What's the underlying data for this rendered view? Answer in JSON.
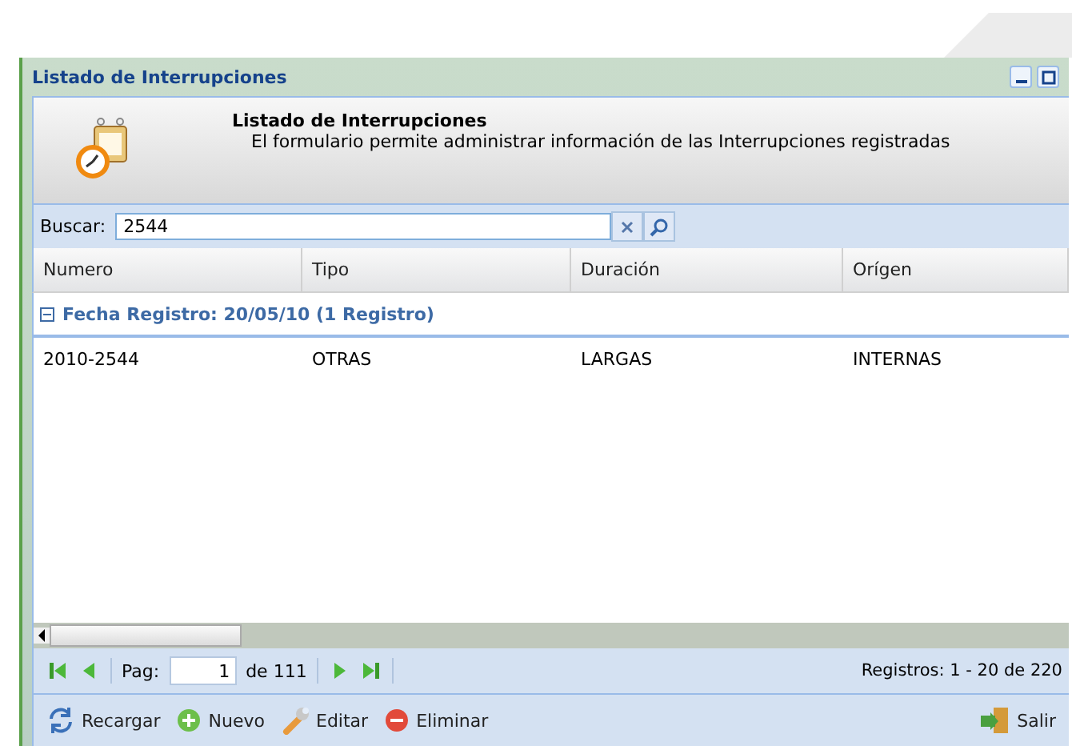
{
  "window": {
    "title": "Listado de Interrupciones"
  },
  "header": {
    "title": "Listado de Interrupciones",
    "description": "El formulario permite administrar información de las Interrupciones registradas"
  },
  "search": {
    "label": "Buscar:",
    "value": "2544"
  },
  "columns": [
    "Numero",
    "Tipo",
    "Duración",
    "Orígen"
  ],
  "group": {
    "label": "Fecha Registro: 20/05/10 (1 Registro)",
    "expanded": true
  },
  "rows": [
    {
      "cells": [
        "2010-2544",
        "OTRAS",
        "LARGAS",
        "INTERNAS"
      ]
    }
  ],
  "pagination": {
    "page_label": "Pag:",
    "page": "1",
    "of": "de 111",
    "summary": "Registros: 1 - 20 de 220"
  },
  "toolbar": [
    {
      "kind": "reload",
      "label": "Recargar"
    },
    {
      "kind": "new",
      "label": "Nuevo"
    },
    {
      "kind": "edit",
      "label": "Editar"
    },
    {
      "kind": "delete",
      "label": "Eliminar"
    }
  ],
  "exit": {
    "label": "Salir"
  }
}
